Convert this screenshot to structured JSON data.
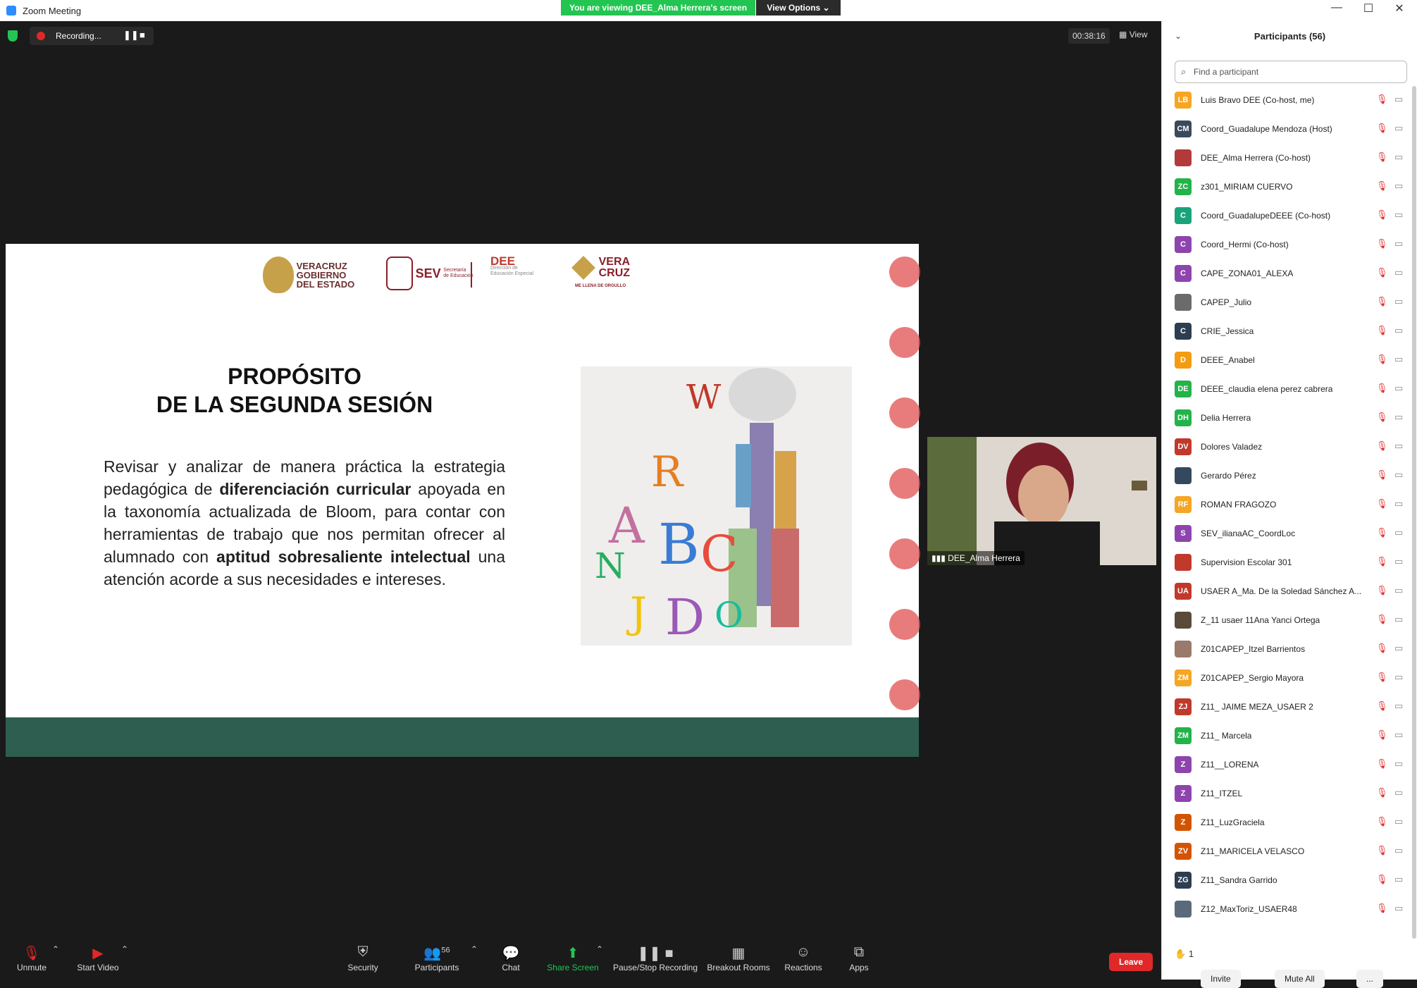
{
  "window": {
    "title": "Zoom Meeting"
  },
  "banner": {
    "viewing": "You are viewing DEE_Alma Herrera's screen",
    "view_options": "View Options ⌄"
  },
  "recording": {
    "label": "Recording...",
    "timer": "00:38:16",
    "view_label": "View"
  },
  "slide": {
    "logos": {
      "veracruz": "VERACRUZ\nGOBIERNO\nDEL ESTADO",
      "sev": "SEV",
      "sev_sub": "Secretaría\nde Educación",
      "dee": "DEE",
      "dee_sub": "Dirección de\nEducación Especial",
      "veracruz2": "VERA\nCRUZ",
      "veracruz2_sub": "ME LLENA DE ORGULLO"
    },
    "title_line1": "PROPÓSITO",
    "title_line2": "DE LA SEGUNDA SESIÓN",
    "text_a": "Revisar y analizar de manera práctica la estrategia pedagógica de ",
    "text_b": "diferenciación curricular",
    "text_c": " apoyada en la taxonomía actualizada de Bloom, para contar con herramientas de trabajo que nos permitan ofrecer al alumnado con ",
    "text_d": "aptitud sobresaliente intelectual",
    "text_e": " una atención acorde a sus necesidades e intereses."
  },
  "camera": {
    "name": "DEE_Alma Herrera"
  },
  "toolbar": {
    "unmute": "Unmute",
    "start_video": "Start Video",
    "security": "Security",
    "participants": "Participants",
    "participant_count": "56",
    "chat": "Chat",
    "share_screen": "Share Screen",
    "pause_stop": "Pause/Stop Recording",
    "breakout": "Breakout Rooms",
    "reactions": "Reactions",
    "apps": "Apps",
    "leave": "Leave"
  },
  "panel": {
    "title": "Participants (56)",
    "search_placeholder": "Find a participant",
    "raised_count": "1",
    "invite": "Invite",
    "mute_all": "Mute All",
    "more": "...",
    "participants": [
      {
        "initials": "LB",
        "name": "Luis Bravo DEE (Co-host, me)",
        "color": "#f5a623"
      },
      {
        "initials": "CM",
        "name": "Coord_Guadalupe Mendoza (Host)",
        "color": "#3a4a5c"
      },
      {
        "initials": "",
        "name": "DEE_Alma Herrera (Co-host)",
        "color": "#b33a3a"
      },
      {
        "initials": "ZC",
        "name": "z301_MIRIAM CUERVO",
        "color": "#23b34a"
      },
      {
        "initials": "C",
        "name": "Coord_GuadalupeDEEE (Co-host)",
        "color": "#1aa37a"
      },
      {
        "initials": "C",
        "name": "Coord_Hermi (Co-host)",
        "color": "#8e44ad"
      },
      {
        "initials": "C",
        "name": "CAPE_ZONA01_ALEXA",
        "color": "#8e44ad"
      },
      {
        "initials": "",
        "name": "CAPEP_Julio",
        "color": "#6b6b6b"
      },
      {
        "initials": "C",
        "name": "CRIE_Jessica",
        "color": "#2c3e50"
      },
      {
        "initials": "D",
        "name": "DEEE_Anabel",
        "color": "#f39c12"
      },
      {
        "initials": "DE",
        "name": "DEEE_claudia elena perez cabrera",
        "color": "#23b34a"
      },
      {
        "initials": "DH",
        "name": "Delia Herrera",
        "color": "#23b34a"
      },
      {
        "initials": "DV",
        "name": "Dolores Valadez",
        "color": "#c0392b"
      },
      {
        "initials": "",
        "name": "Gerardo Pérez",
        "color": "#34495e"
      },
      {
        "initials": "RF",
        "name": "ROMAN FRAGOZO",
        "color": "#f5a623"
      },
      {
        "initials": "S",
        "name": "SEV_ilianaAC_CoordLoc",
        "color": "#8e44ad"
      },
      {
        "initials": "",
        "name": "Supervision Escolar 301",
        "color": "#c0392b"
      },
      {
        "initials": "UA",
        "name": "USAER A_Ma. De la Soledad Sánchez A...",
        "color": "#c0392b"
      },
      {
        "initials": "",
        "name": "Z_11 usaer 11Ana Yanci Ortega",
        "color": "#5a4a3a"
      },
      {
        "initials": "",
        "name": "Z01CAPEP_Itzel Barrientos",
        "color": "#9a7a6a"
      },
      {
        "initials": "ZM",
        "name": "Z01CAPEP_Sergio Mayora",
        "color": "#f5a623"
      },
      {
        "initials": "ZJ",
        "name": "Z11_ JAIME MEZA_USAER 2",
        "color": "#c0392b"
      },
      {
        "initials": "ZM",
        "name": "Z11_ Marcela",
        "color": "#23b34a"
      },
      {
        "initials": "Z",
        "name": "Z11__LORENA",
        "color": "#8e44ad"
      },
      {
        "initials": "Z",
        "name": "Z11_ITZEL",
        "color": "#8e44ad"
      },
      {
        "initials": "Z",
        "name": "Z11_LuzGraciela",
        "color": "#d35400"
      },
      {
        "initials": "ZV",
        "name": "Z11_MARICELA VELASCO",
        "color": "#d35400"
      },
      {
        "initials": "ZG",
        "name": "Z11_Sandra Garrido",
        "color": "#2c3e50"
      },
      {
        "initials": "",
        "name": "Z12_MaxToriz_USAER48",
        "color": "#5a6a7a"
      }
    ]
  }
}
